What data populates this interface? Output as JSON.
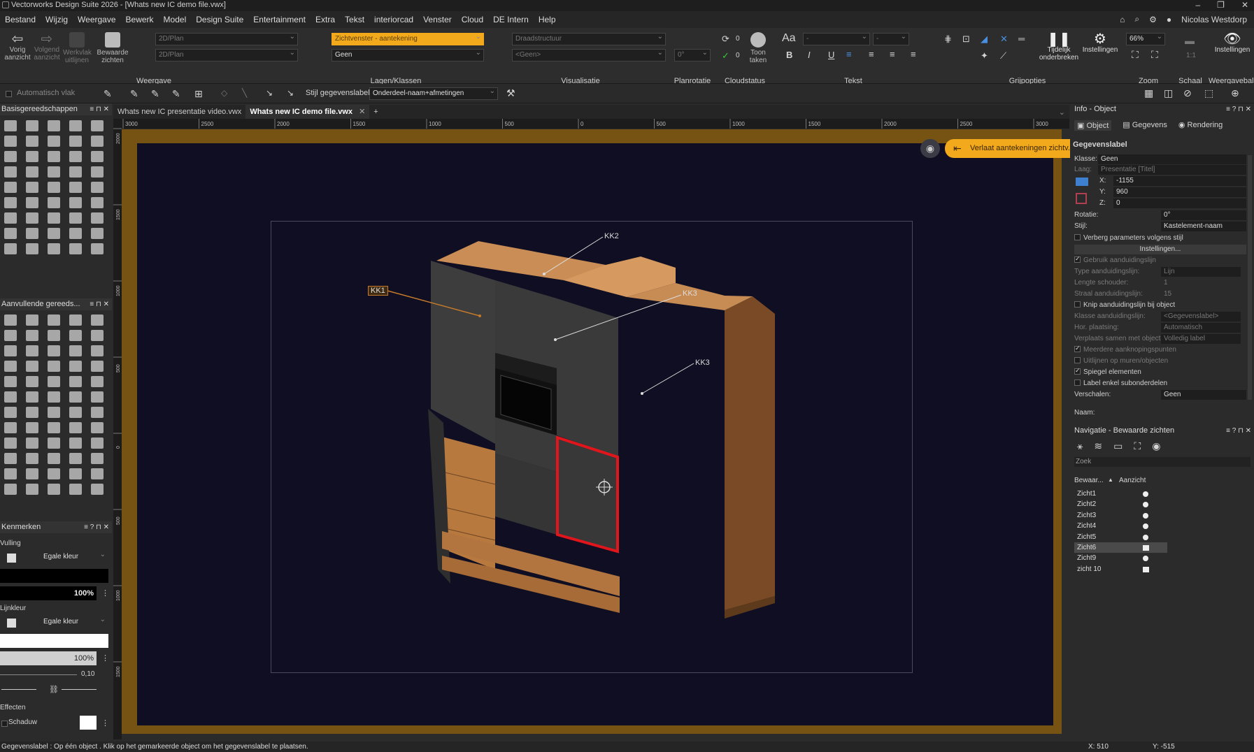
{
  "window": {
    "title": "Vectorworks Design Suite 2026 - [Whats new IC demo file.vwx]",
    "controls": [
      "–",
      "❐",
      "✕"
    ]
  },
  "menu": {
    "items": [
      "Bestand",
      "Wijzig",
      "Weergave",
      "Bewerk",
      "Model",
      "Design Suite",
      "Entertainment",
      "Extra",
      "Tekst",
      "interiorcad",
      "Venster",
      "Cloud",
      "DE Intern",
      "Help"
    ],
    "user": "Nicolas Westdorp"
  },
  "ribbon": {
    "vorig": "Vorig aanzicht",
    "volgend": "Volgend aanzicht",
    "werkvlak": "Werkvlak uitlijnen",
    "bewaarde": "Bewaarde zichten",
    "view_dd1": "2D/Plan",
    "view_dd2": "2D/Plan",
    "layer_dd": "Zichtvenster - aantekening",
    "class_dd": "Geen",
    "render_dd": "Draadstructuur",
    "render_dd2": "<Geen>",
    "rotation_val": "0°",
    "count1": "0",
    "count2": "0",
    "toon": "Toon taken",
    "pauze": "Tijdelijk onderbreken",
    "instellingen": "Instellingen",
    "zoom_val": "66%",
    "schaal_val": "1:1",
    "instellingen2": "Instellingen",
    "groups": {
      "weergave": "Weergave",
      "lagen": "Lagen/Klassen",
      "visualisatie": "Visualisatie",
      "planrotatie": "Planrotatie",
      "cloudstatus": "Cloudstatus",
      "tekst": "Tekst",
      "grijpopties": "Grijpopties",
      "zoom": "Zoom",
      "schaal": "Schaal",
      "weergaveballon": "Weergaveball"
    }
  },
  "toolbar2": {
    "automatisch": "Automatisch vlak",
    "stijl_label": "Stijl gegevenslabel:",
    "stijl_value": "Onderdeel-naam+afmetingen"
  },
  "leftpanels": {
    "basis": "Basisgereedschappen",
    "aanvullend": "Aanvullende gereeds...",
    "kenmerken": "Kenmerken",
    "vulling": "Vulling",
    "vul_type": "Egale kleur",
    "vul_opacity": "100%",
    "lijnkleur": "Lijnkleur",
    "lijn_type": "Egale kleur",
    "lijn_opacity": "100%",
    "lijndikte": "0,10",
    "effecten": "Effecten",
    "schaduw": "Schaduw"
  },
  "tabs": [
    "Whats new IC presentatie video.vwx",
    "Whats new IC demo file.vwx"
  ],
  "ruler_top": [
    "3000",
    "2500",
    "2000",
    "1500",
    "1000",
    "500",
    "0",
    "500",
    "1000",
    "1500",
    "2000",
    "2500",
    "3000"
  ],
  "ruler_left": [
    "2000",
    "1500",
    "1000",
    "500",
    "0",
    "500",
    "1000",
    "1500"
  ],
  "canvas": {
    "leave_btn": "Verlaat aantekeningen zichtv.",
    "labels": {
      "kk1": "KK1",
      "kk2": "KK2",
      "kk3a": "KK3",
      "kk3b": "KK3"
    }
  },
  "info": {
    "title": "Info - Object",
    "tabs": [
      "Object",
      "Gegevens",
      "Rendering"
    ],
    "section": "Gegevenslabel",
    "klasse_label": "Klasse:",
    "klasse": "Geen",
    "laag_label": "Laag:",
    "laag": "Presentatie [Titel]",
    "x_label": "X:",
    "x": "-1155",
    "y_label": "Y:",
    "y": "960",
    "z_label": "Z:",
    "z": "0",
    "rotatie_label": "Rotatie:",
    "rotatie": "0°",
    "stijl_label": "Stijl:",
    "stijl": "Kastelement-naam",
    "verberg": "Verberg parameters volgens stijl",
    "instellingen_btn": "Instellingen...",
    "gebruik": "Gebruik aanduidingslijn",
    "type_label": "Type aanduidingslijn:",
    "type": "Lijn",
    "lengte_label": "Lengte schouder:",
    "lengte": "1",
    "straal_label": "Straal aanduidingslijn:",
    "straal": "15",
    "knip": "Knip aanduidingslijn bij object",
    "klasse2_label": "Klasse aanduidingslijn:",
    "klasse2": "<Gegevenslabel>",
    "hor_label": "Hor. plaatsing:",
    "hor": "Automatisch",
    "verplaats_label": "Verplaats samen met object:",
    "verplaats": "Volledig label",
    "meerdere": "Meerdere aanknopingspunten",
    "uitlijnen": "Uitlijnen op muren/objecten",
    "spiegel": "Spiegel elementen",
    "enkel": "Label enkel subonderdelen",
    "verschalen_label": "Verschalen:",
    "verschalen": "Geen",
    "naam_label": "Naam:"
  },
  "nav": {
    "title": "Navigatie - Bewaarde zichten",
    "search": "Zoek",
    "col1": "Bewaar...",
    "col2": "Aanzicht",
    "rows": [
      "Zicht1",
      "Zicht2",
      "Zicht3",
      "Zicht4",
      "Zicht5",
      "Zicht6",
      "Zicht9",
      "zicht 10"
    ]
  },
  "status": {
    "message": "Gegevenslabel : Op één object . Klik op het gemarkeerde object om het gegevenslabel te plaatsen.",
    "x": "X: 510",
    "y": "Y: -515"
  },
  "colors": {
    "accent": "#f2a91c",
    "canvas_border": "#775313",
    "selection": "#e0161c"
  }
}
